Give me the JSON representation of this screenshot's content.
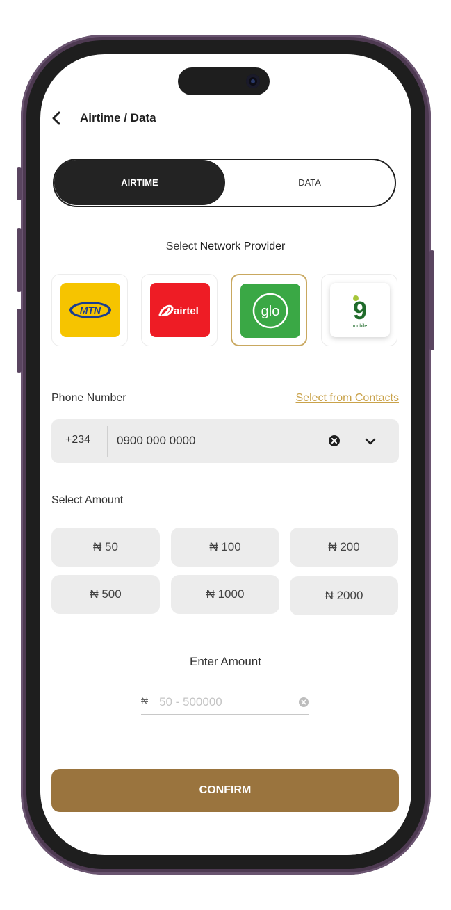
{
  "header": {
    "title": "Airtime / Data"
  },
  "toggle": {
    "airtime_label": "AIRTIME",
    "data_label": "DATA",
    "selected": "AIRTIME"
  },
  "network": {
    "label_prefix": "Select ",
    "label_emph": "Network Provider",
    "providers": [
      {
        "name": "MTN",
        "logo_text": "MTN",
        "color": "#f6c400",
        "selected": false
      },
      {
        "name": "airtel",
        "logo_text": "airtel",
        "color": "#ee1c25",
        "selected": false
      },
      {
        "name": "glo",
        "logo_text": "glo",
        "color": "#3aa845",
        "selected": true
      },
      {
        "name": "9mobile",
        "logo_text": "9",
        "logo_sub": "mobile",
        "color": "#1f6b2a",
        "selected": false
      }
    ],
    "selected_border_color": "#c9a860"
  },
  "phone": {
    "label": "Phone Number",
    "contacts_link": "Select from Contacts",
    "country_code": "+234",
    "value": "0900 000 0000"
  },
  "amount": {
    "label": "Select Amount",
    "options": [
      "₦ 50",
      "₦ 100",
      "₦ 200",
      "₦ 500",
      "₦ 1000",
      "₦ 2000"
    ]
  },
  "enter_amount": {
    "label": "Enter Amount",
    "currency_symbol": "₦",
    "placeholder": "50 - 500000"
  },
  "confirm_label": "CONFIRM",
  "colors": {
    "accent": "#9a743e",
    "link": "#c9a24a",
    "dark": "#232323"
  }
}
